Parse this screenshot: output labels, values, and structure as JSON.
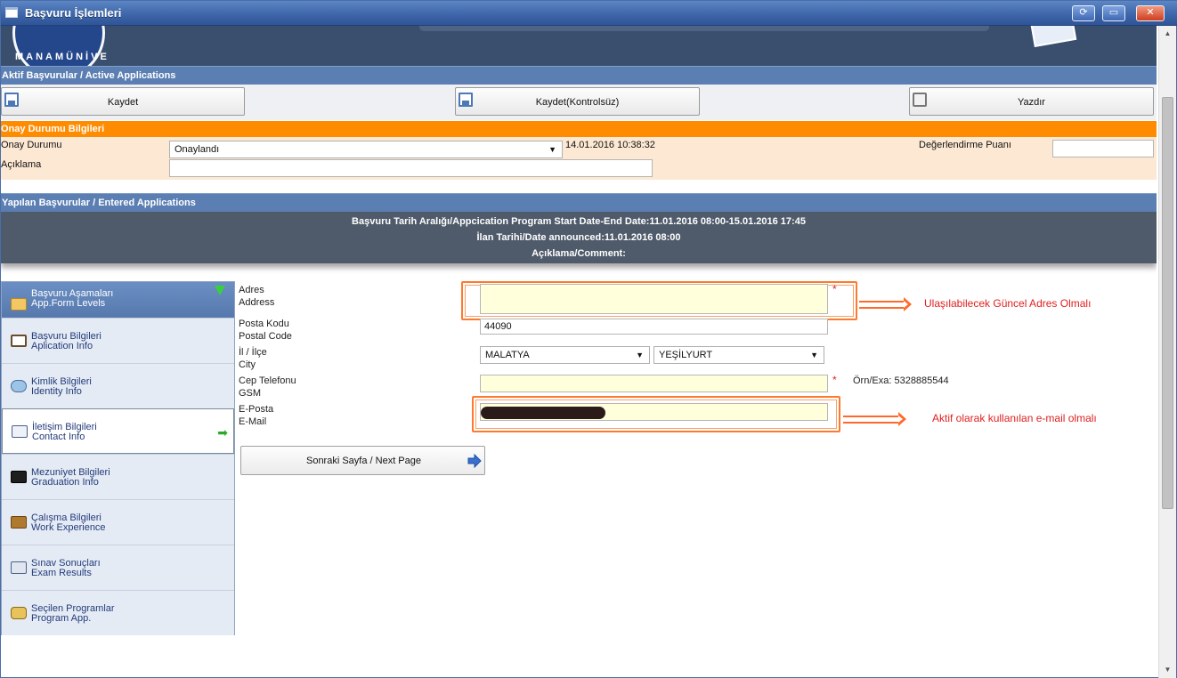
{
  "window": {
    "title": "Başvuru İşlemleri"
  },
  "banner": {
    "logo_text": "MANAMÜNİVE"
  },
  "active_apps": {
    "header": "Aktif Başvurular / Active Applications"
  },
  "toolbar": {
    "save_label": "Kaydet",
    "save_unchecked_label": "Kaydet(Kontrolsüz)",
    "print_label": "Yazdır"
  },
  "approval": {
    "header": "Onay Durumu Bilgileri",
    "status_label": "Onay Durumu",
    "status_value": "Onaylandı",
    "status_time": "14.01.2016 10:38:32",
    "score_label": "Değerlendirme Puanı",
    "score_value": "",
    "comment_label": "Açıklama",
    "comment_value": ""
  },
  "entered": {
    "header": "Yapılan Başvurular / Entered Applications",
    "line1": "Başvuru Tarih Aralığı/Appcication Program Start Date-End Date:11.01.2016 08:00-15.01.2016 17:45",
    "line2": "İlan Tarihi/Date announced:11.01.2016 08:00",
    "line3": "Açıklama/Comment:"
  },
  "sidebar": {
    "header_tr": "Başvuru Aşamaları",
    "header_en": "App.Form Levels",
    "items": [
      {
        "tr": "Başvuru Bilgileri",
        "en": "Aplication Info",
        "icon": "book-icon"
      },
      {
        "tr": "Kimlik Bilgileri",
        "en": "Identity Info",
        "icon": "identity-icon"
      },
      {
        "tr": "İletişim Bilgileri",
        "en": "Contact Info",
        "icon": "contact-card-icon"
      },
      {
        "tr": "Mezuniyet Bilgileri",
        "en": "Graduation Info",
        "icon": "graduation-cap-icon"
      },
      {
        "tr": "Çalışma Bilgileri",
        "en": "Work Experience",
        "icon": "briefcase-icon"
      },
      {
        "tr": "Sınav Sonuçları",
        "en": "Exam Results",
        "icon": "keyboard-icon"
      },
      {
        "tr": "Seçilen Programlar",
        "en": "Program App.",
        "icon": "program-icon"
      }
    ]
  },
  "form": {
    "address_tr": "Adres",
    "address_en": "Address",
    "address_value": "",
    "postal_tr": "Posta Kodu",
    "postal_en": "Postal Code",
    "postal_value": "44090",
    "city_tr": "İl / İlçe",
    "city_en": "City",
    "city_value": "MALATYA",
    "district_value": "YEŞİLYURT",
    "phone_tr": "Cep Telefonu",
    "phone_en": "GSM",
    "phone_value": "",
    "phone_hint": "Örn/Exa: 5328885544",
    "email_tr": "E-Posta",
    "email_en": "E-Mail",
    "required_mark": "*"
  },
  "annotations": {
    "address_note": "Ulaşılabilecek Güncel Adres Olmalı",
    "email_note": "Aktif olarak kullanılan e-mail olmalı"
  },
  "next_button": {
    "label": "Sonraki Sayfa / Next Page"
  },
  "colors": {
    "title_bar": "#3c64a8",
    "section_header": "#5b7fb3",
    "approval_header": "#ff8c00",
    "annotation": "#e02020"
  }
}
